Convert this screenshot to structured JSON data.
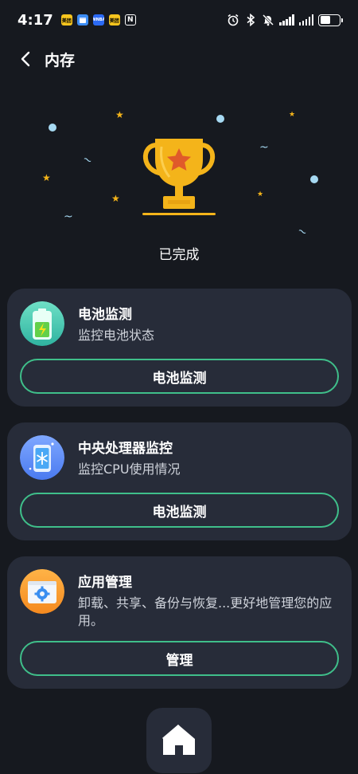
{
  "status_bar": {
    "time": "4:17",
    "badges": [
      {
        "name": "meituan-badge",
        "text": "美团",
        "color": "#f7c51e"
      },
      {
        "name": "calendar-badge",
        "text": "",
        "color": "#3c8df5"
      },
      {
        "name": "app-badge-blue",
        "text": "WNBA",
        "color": "#2b6af5"
      },
      {
        "name": "meituan-badge-2",
        "text": "美团",
        "color": "#f7c51e"
      }
    ],
    "battery_level": 0.55
  },
  "header": {
    "title": "内存"
  },
  "hero": {
    "status_text": "已完成"
  },
  "cards": [
    {
      "title": "电池监测",
      "desc": "监控电池状态",
      "button": "电池监测",
      "icon": "battery-icon"
    },
    {
      "title": "中央处理器监控",
      "desc": "监控CPU使用情况",
      "button": "电池监测",
      "icon": "cpu-cooling-icon"
    },
    {
      "title": "应用管理",
      "desc": "卸载、共享、备份与恢复...更好地管理您的应用。",
      "button": "管理",
      "icon": "app-settings-icon"
    }
  ],
  "colors": {
    "background": "#16191f",
    "card": "#272c39",
    "accent_green": "#3fbf8a",
    "trophy_gold": "#f4b41a"
  }
}
